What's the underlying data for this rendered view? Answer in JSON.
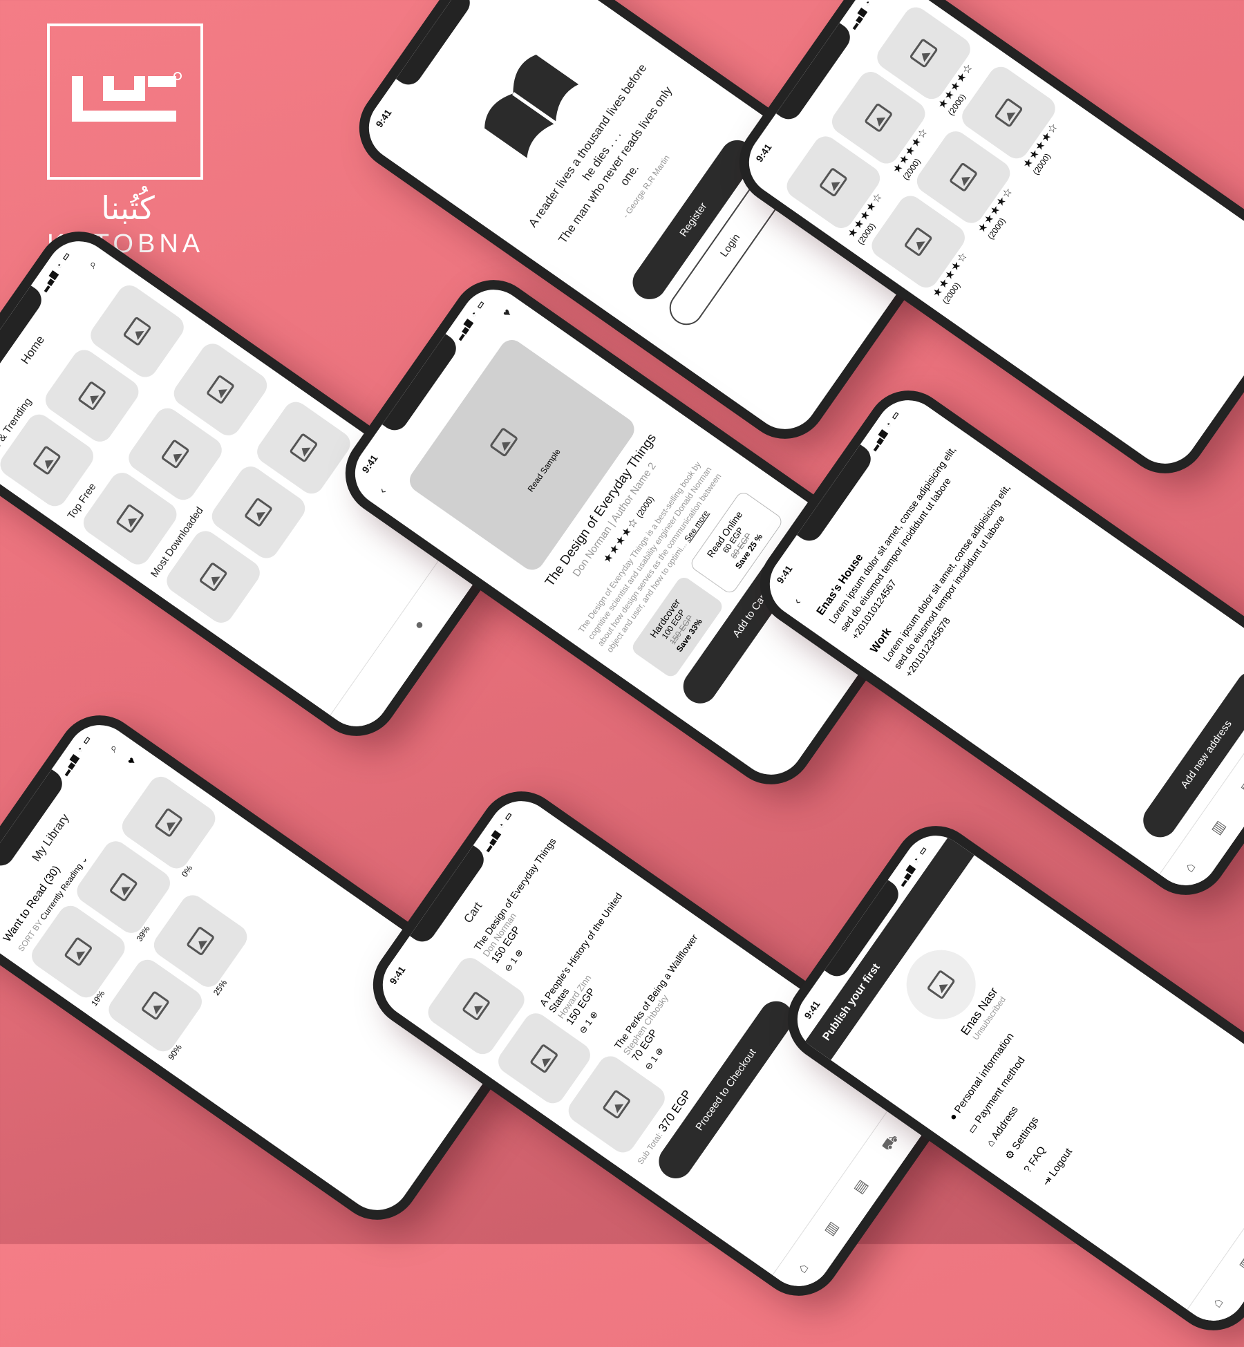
{
  "brand": {
    "arabic": "كُتُبنا",
    "latin": "KOTOBNA",
    "accent": "#f47d86",
    "logo_glyph": "كتـ"
  },
  "status_time": "9:41",
  "welcome": {
    "quote_line1": "A reader lives a thousand lives before he dies . . .",
    "quote_line2": "The man who never reads lives only one.",
    "author": "- George R.R Martin",
    "register": "Register",
    "login": "Login"
  },
  "rating": {
    "stars": "★★★★☆",
    "count": "(2000)"
  },
  "home": {
    "title": "Home",
    "sections": [
      "New & Trending",
      "Top Free",
      "Most Downloaded"
    ]
  },
  "book": {
    "title": "The Design of Everyday Things",
    "author1": "Don Norman",
    "author2": "Author Name 2",
    "read_sample": "Read Sample",
    "rating_count": "(2000)",
    "description": "The Design of Everyday Things is a best-selling book by cognitive scientist and usability engineer Donald Norman about how design serves as the communication between object and user, and how to optimi...",
    "see_more": "See more",
    "formats": [
      {
        "name": "Hardcover",
        "price": "100 EGP",
        "old": "150 EGP",
        "save": "Save 33%"
      },
      {
        "name": "Read Online",
        "price": "60 EGP",
        "old": "80 EGP",
        "save": "Save 25 %"
      }
    ],
    "add_to_cart": "Add to Cart"
  },
  "library": {
    "title": "My Library",
    "want_to_read": "Want to Read (30)",
    "sort_by": "SORT BY",
    "sort_value": "Currently Reading",
    "progress": [
      "19%",
      "39%",
      "0%",
      "90%",
      "25%"
    ]
  },
  "cart": {
    "title": "Cart",
    "items": [
      {
        "title": "The Design of Everyday Things",
        "author": "Don Norman",
        "price": "150 EGP",
        "qty": "1"
      },
      {
        "title": "A People's History of the United States",
        "author": "Howard Zinn",
        "price": "150 EGP",
        "qty": "1"
      },
      {
        "title": "The Perks of Being a Wallflower",
        "author": "Stephen Chbosky",
        "price": "70 EGP",
        "qty": "1"
      }
    ],
    "subtotal_label": "Sub Total:",
    "subtotal": "370 EGP",
    "proceed": "Proceed to Checkout"
  },
  "address": {
    "entries": [
      {
        "name": "Enas's House",
        "text": "Lorem ipsum dolor sit amet, conse adipisicing elit, sed do eiusmod tempor incididunt ut labore",
        "phone": "+201010124567"
      },
      {
        "name": "Work",
        "text": "Lorem ipsum dolor sit amet, conse adipisicing elit, sed do eiusmod tempor incididunt ut labore",
        "phone": "+201012345678"
      }
    ],
    "add_new": "Add new address"
  },
  "profile": {
    "banner": "Publish your first",
    "name": "Enas Nasr",
    "status": "Unsubscribed",
    "menu": [
      "Personal information",
      "Payment method",
      "Address",
      "Settings",
      "FAQ",
      "Logout"
    ]
  }
}
